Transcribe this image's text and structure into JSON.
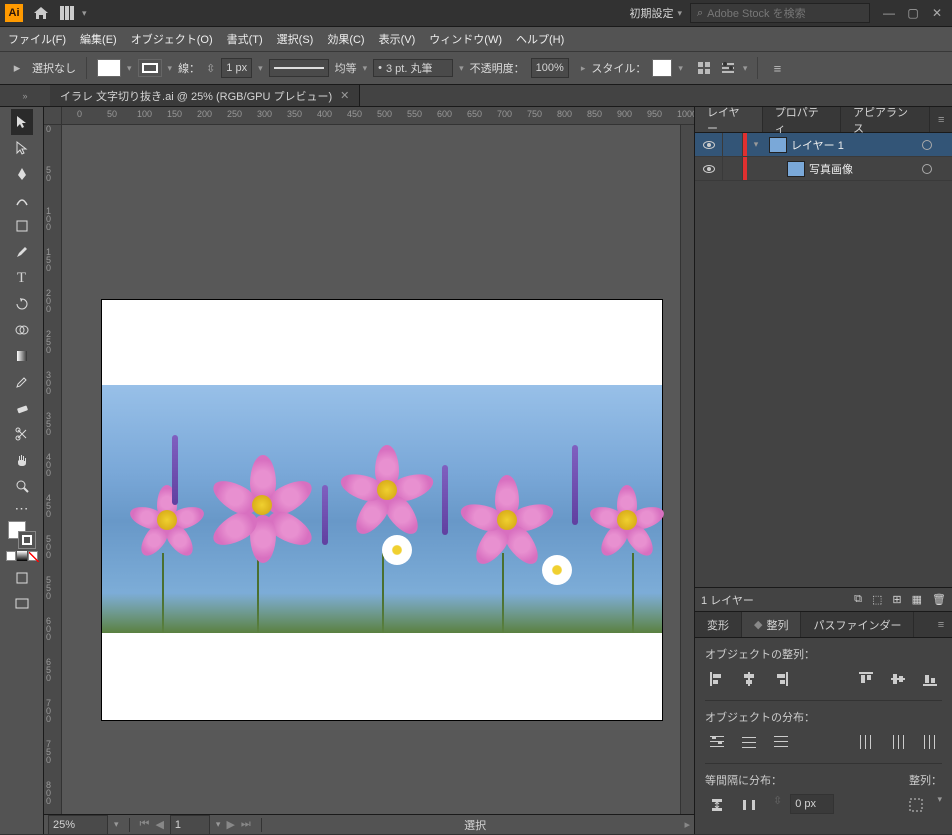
{
  "titlebar": {
    "preset_label": "初期設定",
    "search_placeholder": "Adobe Stock を検索"
  },
  "menu": {
    "file": "ファイル(F)",
    "edit": "編集(E)",
    "object": "オブジェクト(O)",
    "type": "書式(T)",
    "select": "選択(S)",
    "effect": "効果(C)",
    "view": "表示(V)",
    "window": "ウィンドウ(W)",
    "help": "ヘルプ(H)"
  },
  "control": {
    "selection": "選択なし",
    "stroke_label": "線：",
    "stroke_width": "1 px",
    "uniform": "均等",
    "brush": "3 pt. 丸筆",
    "brush_dot": "•",
    "opacity_label": "不透明度：",
    "opacity_value": "100%",
    "style_label": "スタイル："
  },
  "doc": {
    "tab_title": "イラレ 文字切り抜き.ai @ 25% (RGB/GPU プレビュー)"
  },
  "ruler_h": [
    "0",
    "50",
    "100",
    "150",
    "200",
    "250",
    "300",
    "350",
    "400",
    "450",
    "500",
    "550",
    "600",
    "650",
    "700",
    "750",
    "800",
    "850",
    "900",
    "950",
    "1000"
  ],
  "ruler_v": [
    "0",
    "5",
    "0",
    "0",
    "5",
    "0",
    "1",
    "0",
    "0",
    "1",
    "5",
    "0",
    "2",
    "0",
    "0",
    "2",
    "5",
    "0",
    "3",
    "0",
    "0",
    "3",
    "5",
    "0",
    "4",
    "0",
    "0",
    "4",
    "5",
    "0",
    "5",
    "0",
    "0",
    "5",
    "5",
    "0",
    "6",
    "0",
    "0",
    "6",
    "5",
    "0",
    "7",
    "0",
    "0",
    "7",
    "5",
    "0",
    "8",
    "0",
    "0"
  ],
  "status": {
    "zoom": "25%",
    "artboard_nav": "1",
    "tool": "選択"
  },
  "panels": {
    "layers_tab": "レイヤー",
    "properties_tab": "プロパティ",
    "appearance_tab": "アピアランス",
    "layer1_name": "レイヤー 1",
    "layer2_name": "写真画像",
    "layer_count": "1 レイヤー",
    "transform_tab": "変形",
    "align_tab": "整列",
    "pathfinder_tab": "パスファインダー",
    "align_objects": "オブジェクトの整列：",
    "distribute_objects": "オブジェクトの分布：",
    "distribute_spacing": "等間隔に分布：",
    "distribute_px": "0 px",
    "align_to": "整列："
  }
}
